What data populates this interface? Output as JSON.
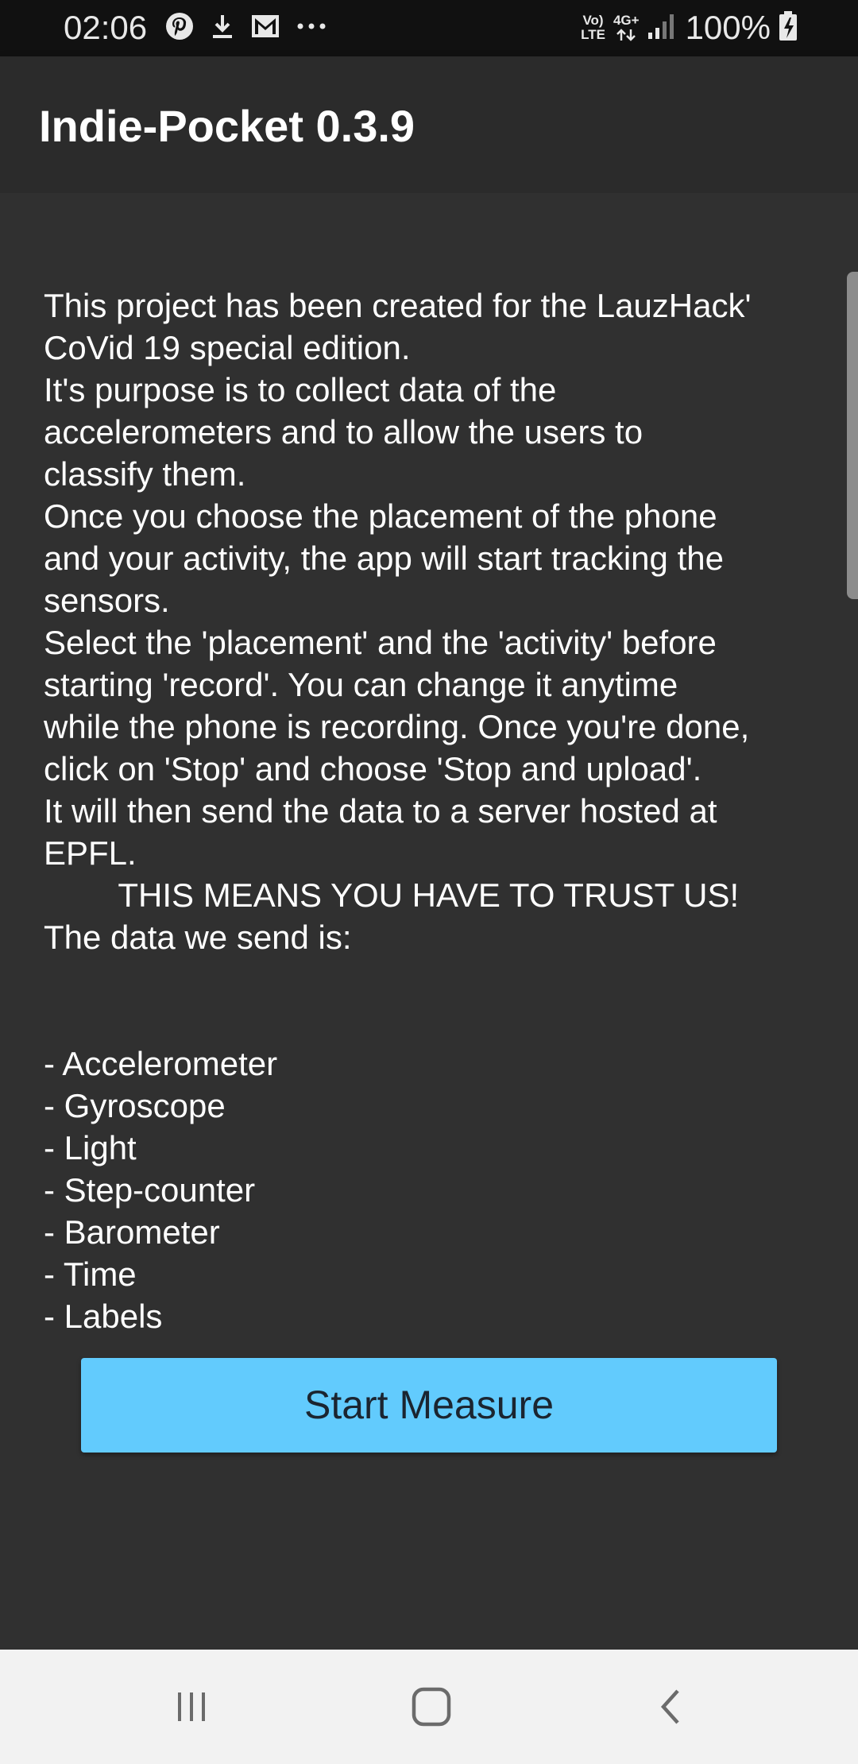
{
  "status_bar": {
    "time": "02:06",
    "left_icons": [
      "pinterest-icon",
      "download-icon",
      "gmail-icon",
      "more-dots-icon"
    ],
    "network_volte": "Vo)\nLTE",
    "network_type": "4G+",
    "battery": "100%"
  },
  "app_bar": {
    "title": "Indie-Pocket 0.3.9"
  },
  "main": {
    "description": "This project has been created for the LauzHack'\nCoVid 19 special edition.\nIt's purpose is to collect data of the\naccelerometers and to allow the users to\nclassify them.\nOnce you choose the placement of the phone\nand your activity, the app will start tracking the\nsensors.\nSelect the 'placement' and the 'activity' before\nstarting 'record'. You can change it anytime\nwhile the phone is recording. Once you're done,\nclick on 'Stop' and choose 'Stop and upload'.\nIt will then send the data to a server hosted at\nEPFL.\n        THIS MEANS YOU HAVE TO TRUST US!\nThe data we send is:\n\n\n- Accelerometer\n- Gyroscope\n- Light\n- Step-counter\n- Barometer\n- Time\n- Labels",
    "start_button_label": "Start Measure"
  },
  "nav_bar": {
    "icons": [
      "recent-apps-icon",
      "home-icon",
      "back-icon"
    ]
  },
  "colors": {
    "background": "#303030",
    "app_bar": "#2b2b2b",
    "button": "#62cbfd",
    "status_bar": "#111111",
    "nav_bar": "#f2f2f2"
  }
}
